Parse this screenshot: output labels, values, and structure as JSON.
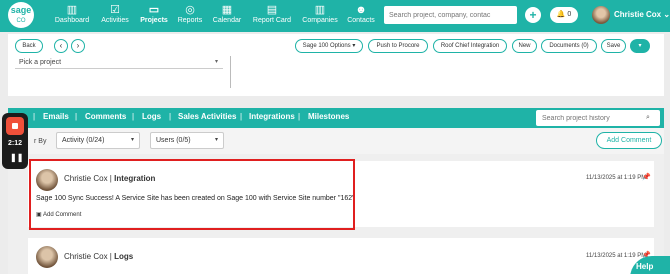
{
  "nav": {
    "logo_top": "sage",
    "logo_bottom": "CO",
    "items": [
      {
        "label": "Dashboard",
        "icon": "dashboard-icon",
        "glyph": "▥"
      },
      {
        "label": "Activities",
        "icon": "activities-icon",
        "glyph": "☑"
      },
      {
        "label": "Projects",
        "icon": "projects-icon",
        "glyph": "▭"
      },
      {
        "label": "Reports",
        "icon": "reports-icon",
        "glyph": "◎"
      },
      {
        "label": "Calendar",
        "icon": "calendar-icon",
        "glyph": "▦"
      },
      {
        "label": "Report Card",
        "icon": "report-card-icon",
        "glyph": "▤"
      },
      {
        "label": "Companies",
        "icon": "companies-icon",
        "glyph": "▥"
      },
      {
        "label": "Contacts",
        "icon": "contacts-icon",
        "glyph": "☻"
      }
    ],
    "active": "Projects",
    "search_placeholder": "Search project, company, contac",
    "plus": "+",
    "notifications": "0",
    "bell": "🔔",
    "user": "Christie Cox",
    "user_caret": "⌄"
  },
  "header": {
    "back": "Back",
    "prev": "‹",
    "next": "›",
    "sage_options": "Sage 100 Options ▾",
    "push_procore": "Push to Procore",
    "roof_chief": "Roof Chief Integration",
    "new": "New",
    "documents": "Documents (0)",
    "save": "Save",
    "more": "▾",
    "pick_project": "Pick a project",
    "caret": "▾"
  },
  "tabs": [
    "Emails",
    "Comments",
    "Logs",
    "Sales Activities",
    "Integrations",
    "Milestones"
  ],
  "tab_separator": "|",
  "history_search_placeholder": "Search project history",
  "search_glyph": "⌕",
  "filter": {
    "label": "r By",
    "activity": "Activity (0/24)",
    "users": "Users (0/5)",
    "caret": "▾",
    "add_comment": "Add Comment"
  },
  "entries": [
    {
      "author": "Christie Cox",
      "sep": " | ",
      "type": "Integration",
      "time": "11/13/2025 at 1:19 PM",
      "pin": "📌",
      "message": "Sage 100 Sync Success! A Service Site has been created on Sage 100 with Service Site number \"162\"",
      "add_comment": "Add Comment",
      "add_glyph": "▣"
    },
    {
      "author": "Christie Cox",
      "sep": " | ",
      "type": "Logs",
      "time": "11/13/2025 at 1:19 PM",
      "pin": "📌"
    }
  ],
  "recorder": {
    "time": "2:12",
    "pause": "❚❚"
  },
  "help": "Help",
  "colors": {
    "accent": "#1fb3a7",
    "highlight": "#e01f1f"
  }
}
